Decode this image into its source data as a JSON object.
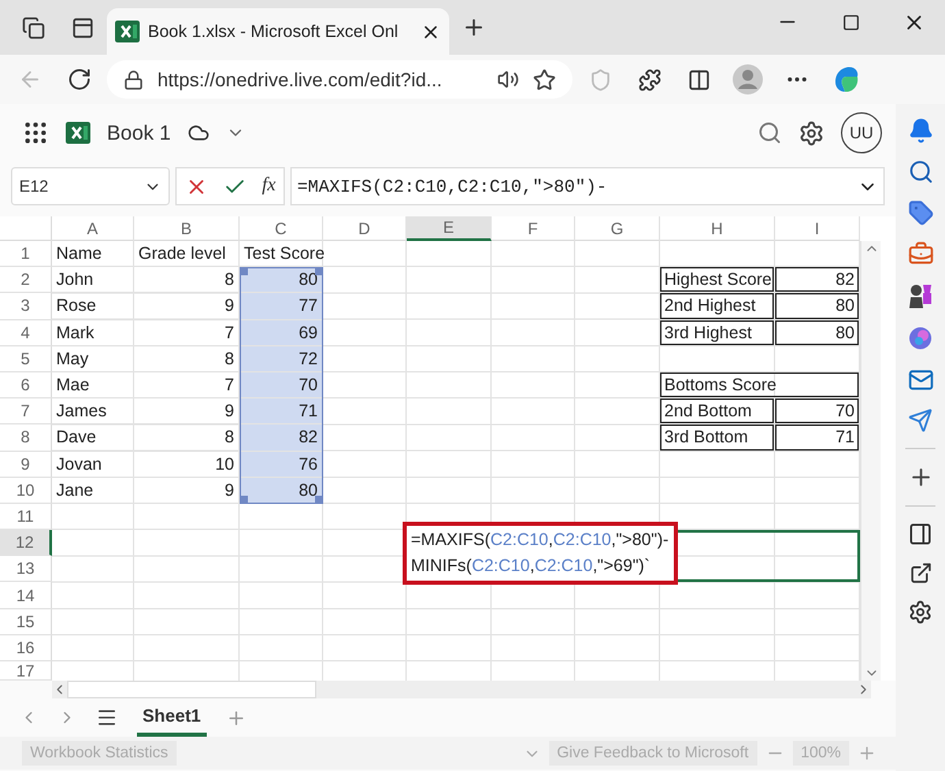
{
  "browser": {
    "tabs": [
      {
        "title": "Book 1.xlsx - Microsoft Excel Onl",
        "selected": true
      }
    ],
    "url": "https://onedrive.live.com/edit?id..."
  },
  "app": {
    "title": "Book 1",
    "avatar": "UU"
  },
  "formula_bar": {
    "name_box": "E12",
    "function_label": "fx",
    "formula": "=MAXIFS(C2:C10,C2:C10,\">80\")-"
  },
  "sheet": {
    "columns": [
      {
        "label": "A",
        "selected": false
      },
      {
        "label": "B",
        "selected": false
      },
      {
        "label": "C",
        "selected": false
      },
      {
        "label": "D",
        "selected": false
      },
      {
        "label": "E",
        "selected": true
      },
      {
        "label": "F",
        "selected": false
      },
      {
        "label": "G",
        "selected": false
      },
      {
        "label": "H",
        "selected": false
      },
      {
        "label": "I",
        "selected": false
      }
    ],
    "rows": [
      {
        "label": "1",
        "selected": false,
        "cells": [
          {
            "text": "Name",
            "kind": "text",
            "selected": false,
            "boxed": false
          },
          {
            "text": "Grade level",
            "kind": "text",
            "selected": false,
            "boxed": false
          },
          {
            "text": "Test Score",
            "kind": "text",
            "selected": false,
            "boxed": false
          },
          null,
          null,
          null,
          null,
          null,
          null
        ]
      },
      {
        "label": "2",
        "selected": false,
        "cells": [
          {
            "text": "John",
            "kind": "text",
            "selected": false,
            "boxed": false
          },
          {
            "text": "8",
            "kind": "number",
            "selected": false,
            "boxed": false
          },
          {
            "text": "80",
            "kind": "number",
            "selected": true,
            "boxed": false
          },
          null,
          null,
          null,
          null,
          {
            "text": "Highest Score",
            "kind": "text",
            "selected": false,
            "boxed": true
          },
          {
            "text": "82",
            "kind": "number",
            "selected": false,
            "boxed": true
          }
        ]
      },
      {
        "label": "3",
        "selected": false,
        "cells": [
          {
            "text": "Rose",
            "kind": "text",
            "selected": false,
            "boxed": false
          },
          {
            "text": "9",
            "kind": "number",
            "selected": false,
            "boxed": false
          },
          {
            "text": "77",
            "kind": "number",
            "selected": true,
            "boxed": false
          },
          null,
          null,
          null,
          null,
          {
            "text": "2nd Highest",
            "kind": "text",
            "selected": false,
            "boxed": true
          },
          {
            "text": "80",
            "kind": "number",
            "selected": false,
            "boxed": true
          }
        ]
      },
      {
        "label": "4",
        "selected": false,
        "cells": [
          {
            "text": "Mark",
            "kind": "text",
            "selected": false,
            "boxed": false
          },
          {
            "text": "7",
            "kind": "number",
            "selected": false,
            "boxed": false
          },
          {
            "text": "69",
            "kind": "number",
            "selected": true,
            "boxed": false
          },
          null,
          null,
          null,
          null,
          {
            "text": "3rd Highest",
            "kind": "text",
            "selected": false,
            "boxed": true
          },
          {
            "text": "80",
            "kind": "number",
            "selected": false,
            "boxed": true
          }
        ]
      },
      {
        "label": "5",
        "selected": false,
        "cells": [
          {
            "text": "May",
            "kind": "text",
            "selected": false,
            "boxed": false
          },
          {
            "text": "8",
            "kind": "number",
            "selected": false,
            "boxed": false
          },
          {
            "text": "72",
            "kind": "number",
            "selected": true,
            "boxed": false
          },
          null,
          null,
          null,
          null,
          null,
          null
        ]
      },
      {
        "label": "6",
        "selected": false,
        "cells": [
          {
            "text": "Mae",
            "kind": "text",
            "selected": false,
            "boxed": false
          },
          {
            "text": "7",
            "kind": "number",
            "selected": false,
            "boxed": false
          },
          {
            "text": "70",
            "kind": "number",
            "selected": true,
            "boxed": false
          },
          null,
          null,
          null,
          null,
          {
            "text": "Bottoms Score",
            "kind": "span",
            "selected": false,
            "boxed": true
          },
          null
        ]
      },
      {
        "label": "7",
        "selected": false,
        "cells": [
          {
            "text": "James",
            "kind": "text",
            "selected": false,
            "boxed": false
          },
          {
            "text": "9",
            "kind": "number",
            "selected": false,
            "boxed": false
          },
          {
            "text": "71",
            "kind": "number",
            "selected": true,
            "boxed": false
          },
          null,
          null,
          null,
          null,
          {
            "text": "2nd Bottom",
            "kind": "text",
            "selected": false,
            "boxed": true
          },
          {
            "text": "70",
            "kind": "number",
            "selected": false,
            "boxed": true
          }
        ]
      },
      {
        "label": "8",
        "selected": false,
        "cells": [
          {
            "text": "Dave",
            "kind": "text",
            "selected": false,
            "boxed": false
          },
          {
            "text": "8",
            "kind": "number",
            "selected": false,
            "boxed": false
          },
          {
            "text": "82",
            "kind": "number",
            "selected": true,
            "boxed": false
          },
          null,
          null,
          null,
          null,
          {
            "text": "3rd Bottom",
            "kind": "text",
            "selected": false,
            "boxed": true
          },
          {
            "text": "71",
            "kind": "number",
            "selected": false,
            "boxed": true
          }
        ]
      },
      {
        "label": "9",
        "selected": false,
        "cells": [
          {
            "text": "Jovan",
            "kind": "text",
            "selected": false,
            "boxed": false
          },
          {
            "text": "10",
            "kind": "number",
            "selected": false,
            "boxed": false
          },
          {
            "text": "76",
            "kind": "number",
            "selected": true,
            "boxed": false
          },
          null,
          null,
          null,
          null,
          null,
          null
        ]
      },
      {
        "label": "10",
        "selected": false,
        "cells": [
          {
            "text": "Jane",
            "kind": "text",
            "selected": false,
            "boxed": false
          },
          {
            "text": "9",
            "kind": "number",
            "selected": false,
            "boxed": false
          },
          {
            "text": "80",
            "kind": "number",
            "selected": true,
            "boxed": false
          },
          null,
          null,
          null,
          null,
          null,
          null
        ]
      },
      {
        "label": "11",
        "selected": false,
        "cells": [
          null,
          null,
          null,
          null,
          null,
          null,
          null,
          null,
          null
        ]
      },
      {
        "label": "12",
        "selected": true,
        "cells": [
          null,
          null,
          null,
          null,
          null,
          null,
          null,
          null,
          null
        ]
      },
      {
        "label": "13",
        "selected": false,
        "cells": [
          null,
          null,
          null,
          null,
          null,
          null,
          null,
          null,
          null
        ]
      },
      {
        "label": "14",
        "selected": false,
        "cells": [
          null,
          null,
          null,
          null,
          null,
          null,
          null,
          null,
          null
        ]
      },
      {
        "label": "15",
        "selected": false,
        "cells": [
          null,
          null,
          null,
          null,
          null,
          null,
          null,
          null,
          null
        ]
      },
      {
        "label": "16",
        "selected": false,
        "cells": [
          null,
          null,
          null,
          null,
          null,
          null,
          null,
          null,
          null
        ]
      },
      {
        "label": "17",
        "selected": false,
        "cells": [
          null,
          null,
          null,
          null,
          null,
          null,
          null,
          null,
          null
        ]
      }
    ],
    "editing_cell": {
      "lines": [
        [
          {
            "text": "=MAXIFS(",
            "kind": "plain"
          },
          {
            "text": "C2:C10",
            "kind": "ref"
          },
          {
            "text": ",",
            "kind": "plain"
          },
          {
            "text": "C2:C10",
            "kind": "ref"
          },
          {
            "text": ",\">80\")-",
            "kind": "plain"
          }
        ],
        [
          {
            "text": "MINIFs(",
            "kind": "plain"
          },
          {
            "text": "C2:C10",
            "kind": "ref"
          },
          {
            "text": ",",
            "kind": "plain"
          },
          {
            "text": "C2:C10",
            "kind": "ref"
          },
          {
            "text": ",\">69\")`",
            "kind": "plain"
          }
        ]
      ]
    },
    "tabs": [
      {
        "label": "Sheet1",
        "selected": true
      }
    ]
  },
  "status_bar": {
    "statistics": "Workbook Statistics",
    "feedback": "Give Feedback to Microsoft",
    "zoom": "100%"
  }
}
